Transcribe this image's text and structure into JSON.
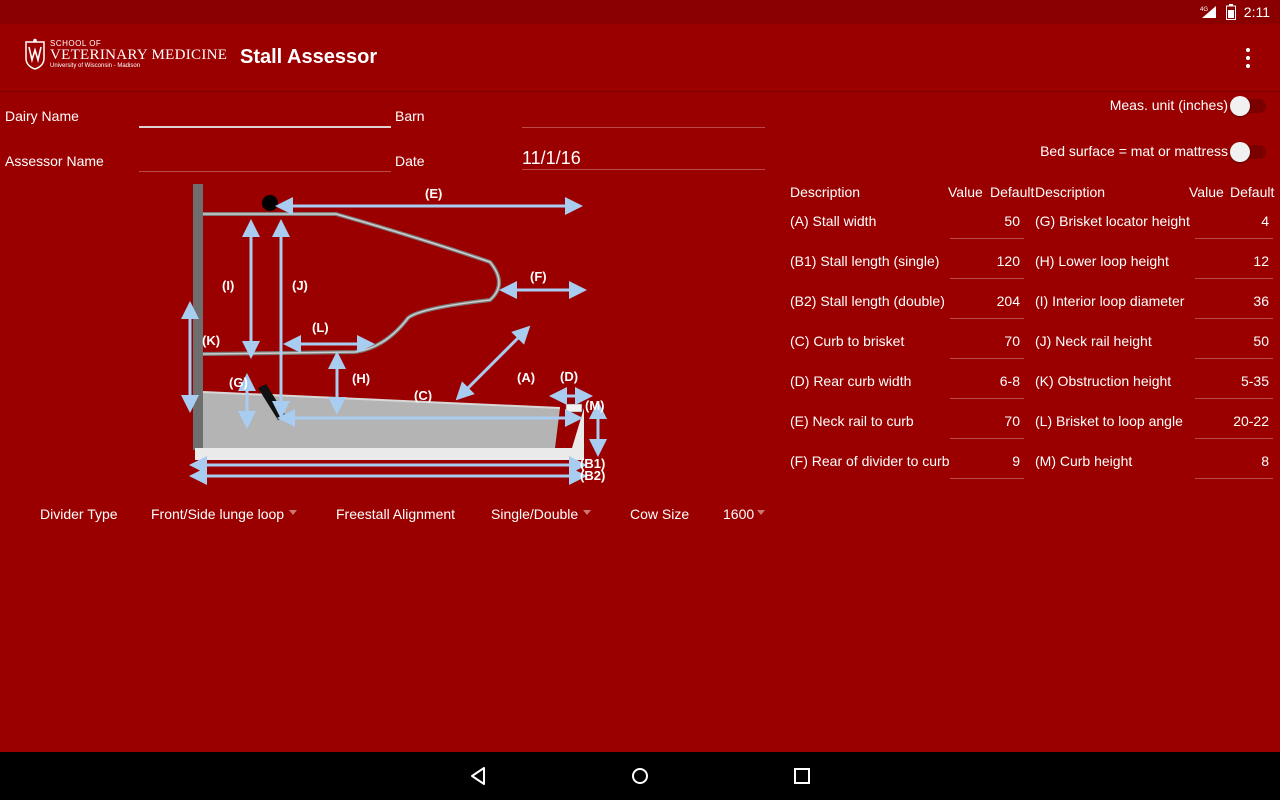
{
  "status_bar": {
    "time": "2:11",
    "network": "4G",
    "icons": [
      "signal-icon",
      "battery-icon"
    ]
  },
  "header": {
    "logo": {
      "line1": "SCHOOL OF",
      "line2": "VETERINARY MEDICINE",
      "line3": "University of Wisconsin - Madison"
    },
    "title": "Stall Assessor",
    "overflow_icon": "more-vert-icon"
  },
  "form": {
    "dairy_name_label": "Dairy Name",
    "dairy_name_value": "",
    "barn_label": "Barn",
    "barn_value": "",
    "assessor_name_label": "Assessor Name",
    "assessor_name_value": "",
    "date_label": "Date",
    "date_value": "11/1/16"
  },
  "diagram": {
    "labels": {
      "E": "(E)",
      "F": "(F)",
      "I": "(I)",
      "J": "(J)",
      "K": "(K)",
      "L": "(L)",
      "G": "(G)",
      "H": "(H)",
      "C": "(C)",
      "A": "(A)",
      "D": "(D)",
      "M": "(M)",
      "B1": "(B1)",
      "B2": "(B2)"
    },
    "colors": {
      "arrow": "#a8cdf0",
      "rail": "#9a9a9a",
      "bed": "#b0b0b0",
      "curb": "#e8e8e8",
      "post": "#6e6e6e"
    }
  },
  "selectors": {
    "divider_type_label": "Divider Type",
    "divider_type_value": "Front/Side lunge loop",
    "alignment_label": "Freestall Alignment",
    "alignment_value": "Single/Double",
    "cow_size_label": "Cow Size",
    "cow_size_value": "1600"
  },
  "toggles": {
    "meas_unit_label": "Meas. unit (inches)",
    "meas_unit_on": false,
    "bed_surface_label": "Bed surface = mat or mattress",
    "bed_surface_on": false
  },
  "table": {
    "headers": {
      "description": "Description",
      "value": "Value",
      "default": "Default"
    },
    "left": [
      {
        "description": "(A) Stall width",
        "value": "",
        "default": "50"
      },
      {
        "description": "(B1) Stall length (single)",
        "value": "",
        "default": "120"
      },
      {
        "description": "(B2) Stall length (double)",
        "value": "",
        "default": "204"
      },
      {
        "description": "(C) Curb to brisket",
        "value": "",
        "default": "70"
      },
      {
        "description": "(D) Rear curb width",
        "value": "",
        "default": "6-8"
      },
      {
        "description": "(E) Neck rail to curb",
        "value": "",
        "default": "70"
      },
      {
        "description": "(F) Rear of divider to curb",
        "value": "",
        "default": "9"
      }
    ],
    "right": [
      {
        "description": "(G) Brisket locator height",
        "value": "",
        "default": "4"
      },
      {
        "description": "(H) Lower loop height",
        "value": "",
        "default": "12"
      },
      {
        "description": "(I) Interior loop diameter",
        "value": "",
        "default": "36"
      },
      {
        "description": "(J) Neck rail height",
        "value": "",
        "default": "50"
      },
      {
        "description": "(K) Obstruction height",
        "value": "",
        "default": "5-35"
      },
      {
        "description": "(L) Brisket to loop angle",
        "value": "",
        "default": "20-22"
      },
      {
        "description": "(M) Curb height",
        "value": "",
        "default": "8"
      }
    ]
  },
  "navbar": {
    "icons": [
      "back-icon",
      "home-icon",
      "recents-icon"
    ]
  },
  "colors": {
    "background": "#9b0000",
    "statusbar": "#8a0000",
    "navbar": "#000000",
    "underline": "#b84a4a"
  }
}
